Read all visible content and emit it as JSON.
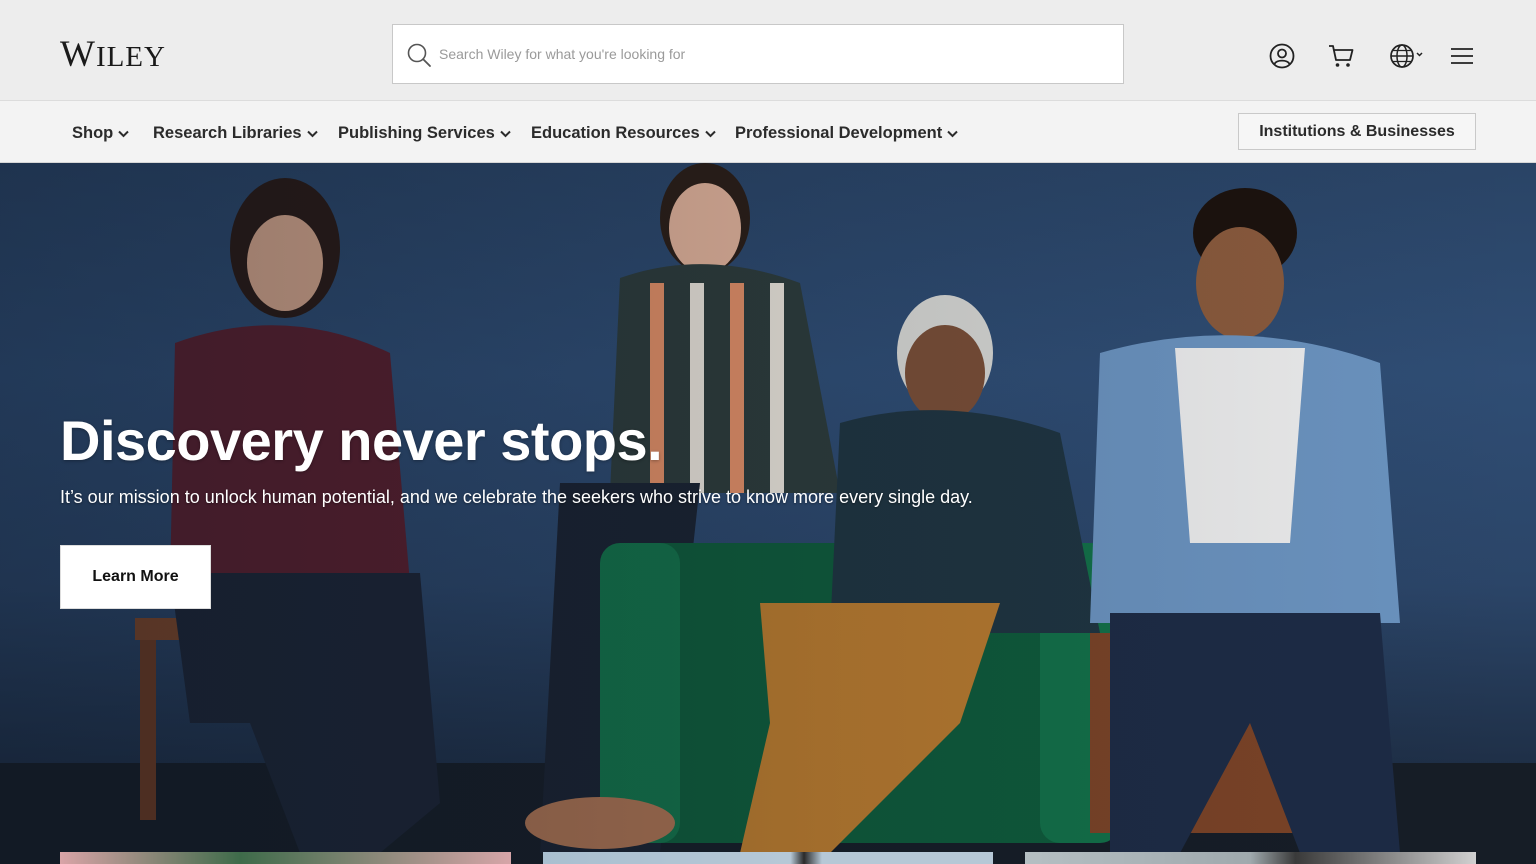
{
  "header": {
    "logo_first": "W",
    "logo_rest": "ILEY",
    "search_placeholder": "Search Wiley for what you're looking for",
    "icons": [
      "search-icon",
      "account-icon",
      "cart-icon",
      "globe-icon",
      "menu-icon"
    ]
  },
  "nav": {
    "items": [
      {
        "label": "Shop"
      },
      {
        "label": "Research Libraries"
      },
      {
        "label": "Publishing Services"
      },
      {
        "label": "Education Resources"
      },
      {
        "label": "Professional Development"
      }
    ],
    "institutions_label": "Institutions & Businesses"
  },
  "hero": {
    "heading": "Discovery never stops.",
    "subtext": "It’s our mission to unlock human potential, and we celebrate the seekers who strive to know more every single day.",
    "cta_label": "Learn More"
  },
  "colors": {
    "header_bg": "#ededed",
    "nav_bg": "#f3f3f3",
    "hero_bg": "#2b4568",
    "text_dark": "#2b2b2b",
    "button_bg": "#ffffff"
  }
}
